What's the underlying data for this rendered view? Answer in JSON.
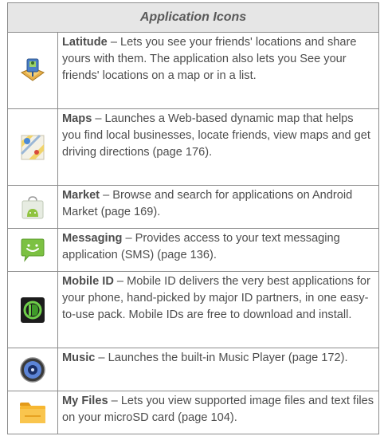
{
  "header": {
    "title": "Application Icons"
  },
  "rows": [
    {
      "icon": "latitude-icon",
      "name": "Latitude",
      "text": " – Lets you see your friends' locations and share yours with them. The application also lets you See your friends' locations on a map or in a list."
    },
    {
      "icon": "maps-icon",
      "name": "Maps",
      "text": " – Launches a Web-based dynamic map that helps you find local businesses, locate friends, view maps and get driving directions (page 176)."
    },
    {
      "icon": "market-icon",
      "name": "Market",
      "text": " – Browse and search for applications on Android Market (page 169)."
    },
    {
      "icon": "messaging-icon",
      "name": "Messaging",
      "text": " – Provides access to your text messaging application (SMS) (page 136)."
    },
    {
      "icon": "mobile-id-icon",
      "name": "Mobile ID",
      "text": " – Mobile ID delivers the very best applications for your phone, hand-picked by major ID partners, in one easy-to-use pack. Mobile IDs are free to download and install."
    },
    {
      "icon": "music-icon",
      "name": "Music",
      "text": " – Launches the built-in Music Player (page 172)."
    },
    {
      "icon": "my-files-icon",
      "name": "My Files",
      "text": " – Lets you view supported image files and text files on your microSD card (page 104)."
    }
  ]
}
